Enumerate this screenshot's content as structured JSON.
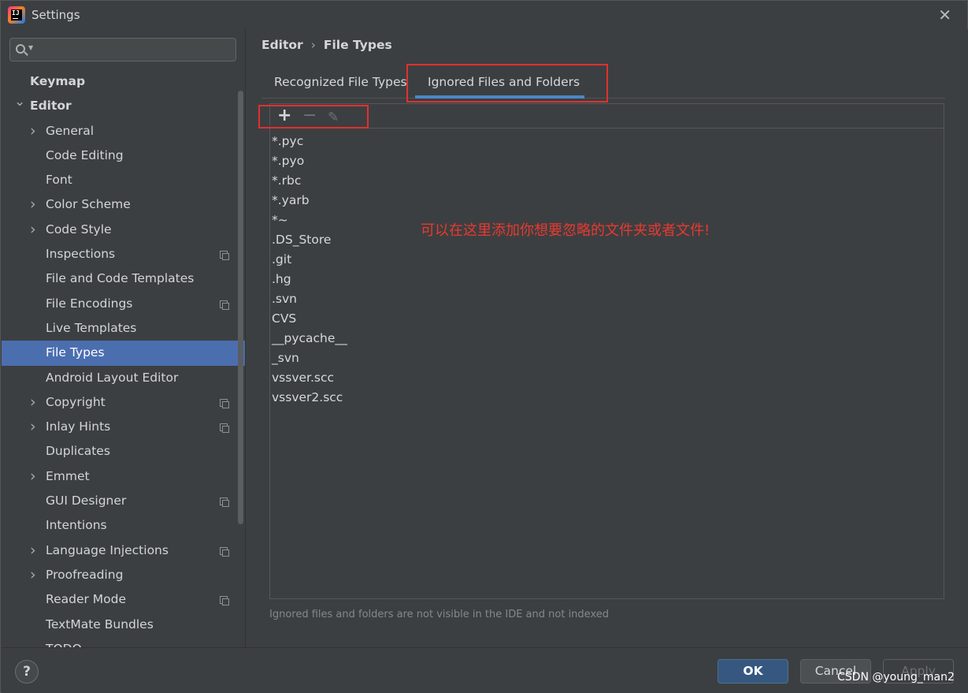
{
  "window": {
    "title": "Settings"
  },
  "sidebar": {
    "search": {
      "placeholder": ""
    },
    "items": [
      {
        "label": "Keymap",
        "bold": true,
        "indent": 0,
        "expander": "none",
        "badge": false
      },
      {
        "label": "Editor",
        "bold": true,
        "indent": 0,
        "expander": "expanded",
        "badge": false
      },
      {
        "label": "General",
        "bold": false,
        "indent": 1,
        "expander": "collapsed",
        "badge": false
      },
      {
        "label": "Code Editing",
        "bold": false,
        "indent": 1,
        "expander": "none",
        "badge": false
      },
      {
        "label": "Font",
        "bold": false,
        "indent": 1,
        "expander": "none",
        "badge": false
      },
      {
        "label": "Color Scheme",
        "bold": false,
        "indent": 1,
        "expander": "collapsed",
        "badge": false
      },
      {
        "label": "Code Style",
        "bold": false,
        "indent": 1,
        "expander": "collapsed",
        "badge": false
      },
      {
        "label": "Inspections",
        "bold": false,
        "indent": 1,
        "expander": "none",
        "badge": true
      },
      {
        "label": "File and Code Templates",
        "bold": false,
        "indent": 1,
        "expander": "none",
        "badge": false
      },
      {
        "label": "File Encodings",
        "bold": false,
        "indent": 1,
        "expander": "none",
        "badge": true
      },
      {
        "label": "Live Templates",
        "bold": false,
        "indent": 1,
        "expander": "none",
        "badge": false
      },
      {
        "label": "File Types",
        "bold": false,
        "indent": 1,
        "expander": "none",
        "badge": false,
        "selected": true
      },
      {
        "label": "Android Layout Editor",
        "bold": false,
        "indent": 1,
        "expander": "none",
        "badge": false
      },
      {
        "label": "Copyright",
        "bold": false,
        "indent": 1,
        "expander": "collapsed",
        "badge": true
      },
      {
        "label": "Inlay Hints",
        "bold": false,
        "indent": 1,
        "expander": "collapsed",
        "badge": true
      },
      {
        "label": "Duplicates",
        "bold": false,
        "indent": 1,
        "expander": "none",
        "badge": false
      },
      {
        "label": "Emmet",
        "bold": false,
        "indent": 1,
        "expander": "collapsed",
        "badge": false
      },
      {
        "label": "GUI Designer",
        "bold": false,
        "indent": 1,
        "expander": "none",
        "badge": true
      },
      {
        "label": "Intentions",
        "bold": false,
        "indent": 1,
        "expander": "none",
        "badge": false
      },
      {
        "label": "Language Injections",
        "bold": false,
        "indent": 1,
        "expander": "collapsed",
        "badge": true
      },
      {
        "label": "Proofreading",
        "bold": false,
        "indent": 1,
        "expander": "collapsed",
        "badge": false
      },
      {
        "label": "Reader Mode",
        "bold": false,
        "indent": 1,
        "expander": "none",
        "badge": true
      },
      {
        "label": "TextMate Bundles",
        "bold": false,
        "indent": 1,
        "expander": "none",
        "badge": false
      },
      {
        "label": "TODO",
        "bold": false,
        "indent": 1,
        "expander": "none",
        "badge": false
      }
    ]
  },
  "breadcrumb": {
    "parent": "Editor",
    "separator": "›",
    "current": "File Types"
  },
  "tabs": {
    "recognized": "Recognized File Types",
    "ignored": "Ignored Files and Folders",
    "active": "ignored"
  },
  "toolbar": {
    "add": "+",
    "remove": "−",
    "edit_icon": "pencil-icon"
  },
  "ignored_files": [
    "*.pyc",
    "*.pyo",
    "*.rbc",
    "*.yarb",
    "*~",
    ".DS_Store",
    ".git",
    ".hg",
    ".svn",
    "CVS",
    "__pycache__",
    "_svn",
    "vssver.scc",
    "vssver2.scc"
  ],
  "annotation": "可以在这里添加你想要忽略的文件夹或者文件!",
  "hint": "Ignored files and folders are not visible in the IDE and not indexed",
  "footer": {
    "help": "?",
    "ok": "OK",
    "cancel": "Cancel",
    "apply": "Apply"
  },
  "watermark": "CSDN @young_man2",
  "colors": {
    "selection": "#4b6eaf",
    "accent": "#4a88c7",
    "highlight_box": "#e0312e",
    "ok_button": "#365880"
  }
}
